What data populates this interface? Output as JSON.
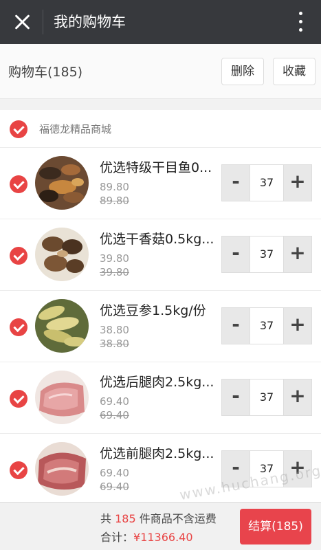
{
  "topbar": {
    "title": "我的购物车"
  },
  "subhead": {
    "label": "购物车(185)",
    "delete_label": "删除",
    "favorite_label": "收藏"
  },
  "shop": {
    "name": "福德龙精品商城"
  },
  "items": [
    {
      "name": "优选特级干目鱼0...",
      "price": "89.80",
      "original_price": "89.80",
      "qty": "37"
    },
    {
      "name": "优选干香菇0.5kg...",
      "price": "39.80",
      "original_price": "39.80",
      "qty": "37"
    },
    {
      "name": "优选豆参1.5kg/份",
      "price": "38.80",
      "original_price": "38.80",
      "qty": "37"
    },
    {
      "name": "优选后腿肉2.5kg...",
      "price": "69.40",
      "original_price": "69.40",
      "qty": "37"
    },
    {
      "name": "优选前腿肉2.5kg...",
      "price": "69.40",
      "original_price": "69.40",
      "qty": "37"
    }
  ],
  "stepper": {
    "minus": "-",
    "plus": "+"
  },
  "footer": {
    "prefix": "共 ",
    "count": "185",
    "suffix": " 件商品不含运费",
    "total_label": "合计：",
    "total": "¥11366.40",
    "checkout_label": "结算(185)"
  },
  "watermark": "www.huchang.org"
}
